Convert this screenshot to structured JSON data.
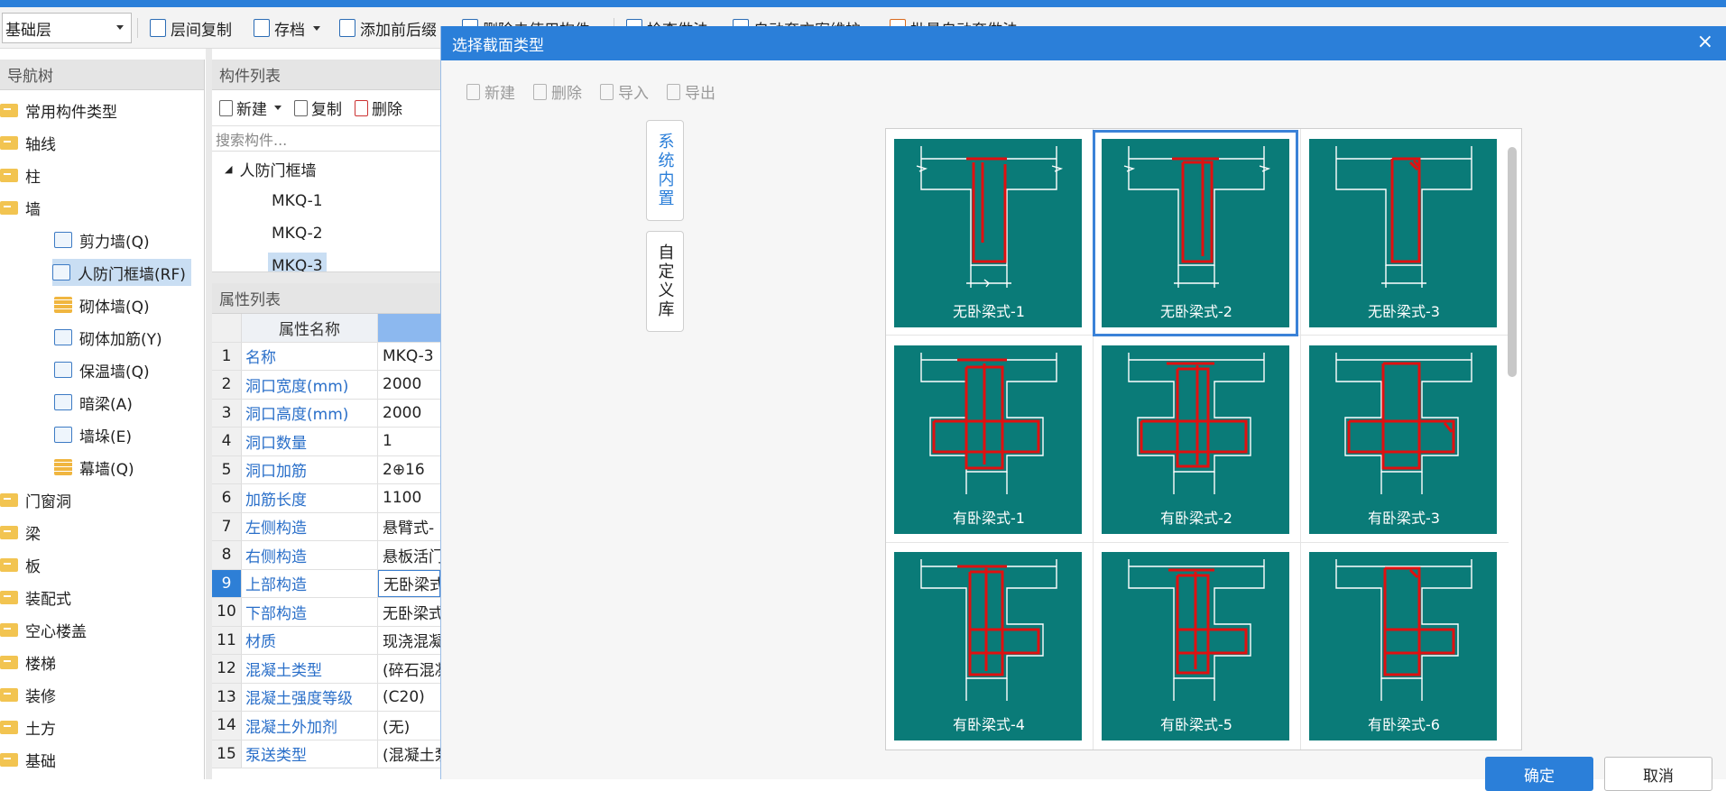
{
  "toolbar": {
    "floor": "基础层",
    "items": [
      "层间复制",
      "存档",
      "添加前后缀",
      "删除未使用构件",
      "检查做法",
      "自动套方案维护",
      "批量自动套做法"
    ]
  },
  "nav": {
    "title": "导航树",
    "items": [
      "常用构件类型",
      "轴线",
      "柱",
      "墙",
      "剪力墙(Q)",
      "人防门框墙(RF)",
      "砌体墙(Q)",
      "砌体加筋(Y)",
      "保温墙(Q)",
      "暗梁(A)",
      "墙垛(E)",
      "幕墙(Q)",
      "门窗洞",
      "梁",
      "板",
      "装配式",
      "空心楼盖",
      "楼梯",
      "装修",
      "土方",
      "基础"
    ]
  },
  "components": {
    "title": "构件列表",
    "new": "新建",
    "copy": "复制",
    "delete": "删除",
    "search_placeholder": "搜索构件...",
    "group": "人防门框墙",
    "items": [
      "MKQ-1",
      "MKQ-2",
      "MKQ-3"
    ]
  },
  "props": {
    "title": "属性列表",
    "header_name": "属性名称",
    "header_value": "",
    "rows": [
      {
        "n": "1",
        "k": "名称",
        "v": "MKQ-3"
      },
      {
        "n": "2",
        "k": "洞口宽度(mm)",
        "v": "2000"
      },
      {
        "n": "3",
        "k": "洞口高度(mm)",
        "v": "2000"
      },
      {
        "n": "4",
        "k": "洞口数量",
        "v": "1"
      },
      {
        "n": "5",
        "k": "洞口加筋",
        "v": "2⊕16"
      },
      {
        "n": "6",
        "k": "加筋长度",
        "v": "1100"
      },
      {
        "n": "7",
        "k": "左侧构造",
        "v": "悬臂式-"
      },
      {
        "n": "8",
        "k": "右侧构造",
        "v": "悬板活门"
      },
      {
        "n": "9",
        "k": "上部构造",
        "v": "无卧梁式"
      },
      {
        "n": "10",
        "k": "下部构造",
        "v": "无卧梁式"
      },
      {
        "n": "11",
        "k": "材质",
        "v": "现浇混凝"
      },
      {
        "n": "12",
        "k": "混凝土类型",
        "v": "(碎石混凝"
      },
      {
        "n": "13",
        "k": "混凝土强度等级",
        "v": "(C20)"
      },
      {
        "n": "14",
        "k": "混凝土外加剂",
        "v": "(无)"
      },
      {
        "n": "15",
        "k": "泵送类型",
        "v": "(混凝土泵"
      }
    ]
  },
  "dialog": {
    "title": "选择截面类型",
    "close": "×",
    "toolbar": [
      "新建",
      "删除",
      "导入",
      "导出"
    ],
    "tab_system": "系统内置",
    "tab_custom": "自定义库",
    "sections": [
      "无卧梁式-1",
      "无卧梁式-2",
      "无卧梁式-3",
      "有卧梁式-1",
      "有卧梁式-2",
      "有卧梁式-3",
      "有卧梁式-4",
      "有卧梁式-5",
      "有卧梁式-6"
    ],
    "ok": "确定",
    "cancel": "取消"
  }
}
